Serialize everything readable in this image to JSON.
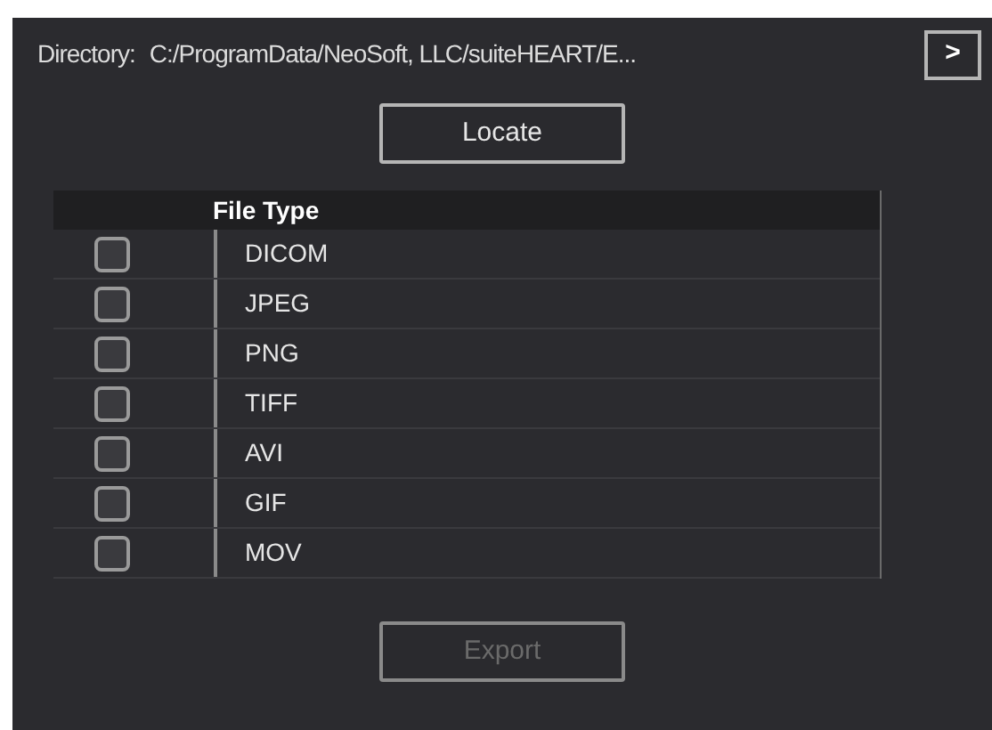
{
  "directory": {
    "label": "Directory:",
    "path": "C:/ProgramData/NeoSoft, LLC/suiteHEART/E...",
    "browse_button": ">"
  },
  "locate_button": {
    "label": "Locate",
    "disabled": false
  },
  "table": {
    "columns": [
      "File Type"
    ],
    "rows": [
      {
        "name": "DICOM",
        "checked": false
      },
      {
        "name": "JPEG",
        "checked": false
      },
      {
        "name": "PNG",
        "checked": false
      },
      {
        "name": "TIFF",
        "checked": false
      },
      {
        "name": "AVI",
        "checked": false
      },
      {
        "name": "GIF",
        "checked": false
      },
      {
        "name": "MOV",
        "checked": false
      }
    ]
  },
  "export_button": {
    "label": "Export",
    "disabled": true
  }
}
